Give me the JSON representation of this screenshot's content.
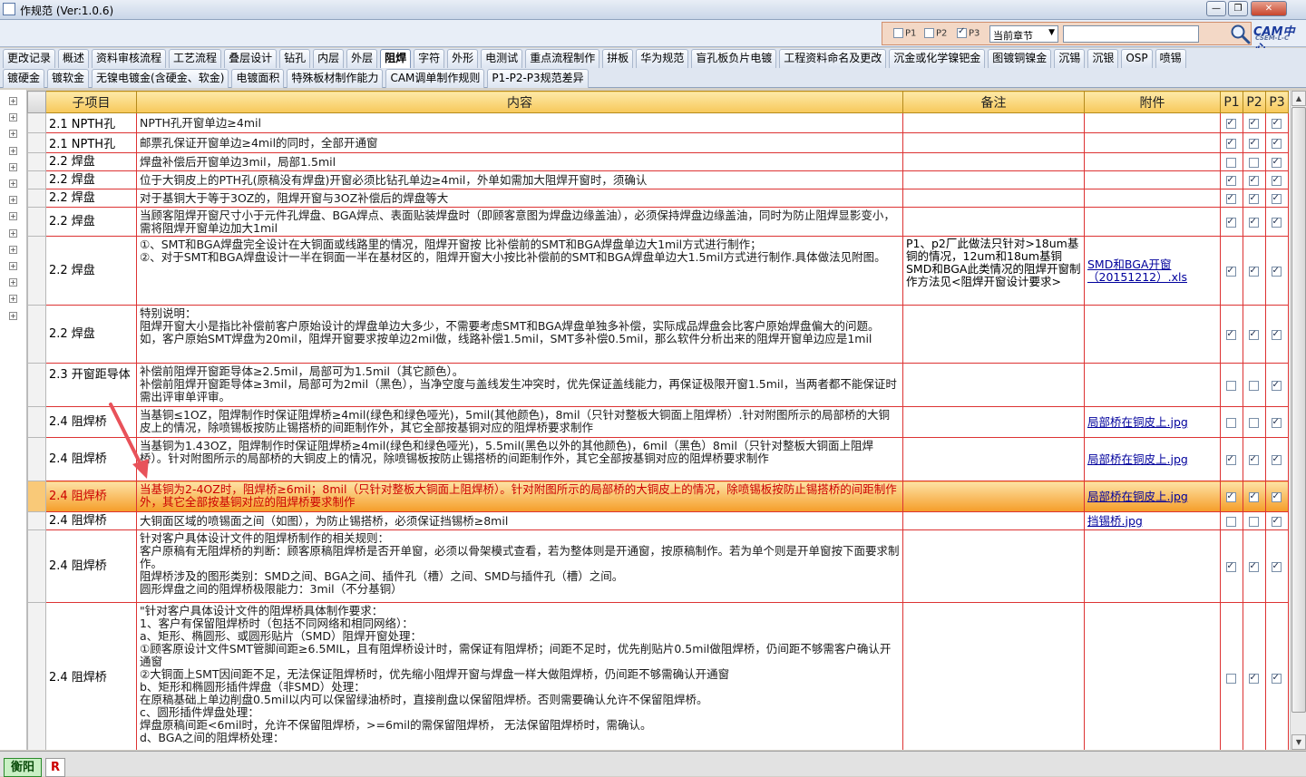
{
  "window": {
    "title": "作规范 (Ver:1.0.6)",
    "controls": [
      "—",
      "❐",
      "✕"
    ]
  },
  "toolbar": {
    "filters": [
      {
        "label": "P1",
        "checked": false
      },
      {
        "label": "P2",
        "checked": false
      },
      {
        "label": "P3",
        "checked": true
      }
    ],
    "chapter_select": "当前章节",
    "search_value": "",
    "logo_text": "CAM中心",
    "logo_sub": "CSEM-L-C"
  },
  "tabs_row1": [
    "更改记录",
    "概述",
    "资料审核流程",
    "工艺流程",
    "叠层设计",
    "钻孔",
    "内层",
    "外层",
    "阻焊",
    "字符",
    "外形",
    "电测试",
    "重点流程制作",
    "拼板",
    "华为规范",
    "盲孔板负片电镀",
    "工程资料命名及更改",
    "沉金或化学镍钯金",
    "图镀铜镍金",
    "沉锡",
    "沉银",
    "OSP",
    "喷锡"
  ],
  "tabs_row2": [
    "镀硬金",
    "镀软金",
    "无镍电镀金(含硬金、软金)",
    "电镀面积",
    "特殊板材制作能力",
    "CAM调单制作规则",
    "P1-P2-P3规范差异"
  ],
  "active_tab": "阻焊",
  "table": {
    "headers": [
      "子项目",
      "内容",
      "备注",
      "附件",
      "P1",
      "P2",
      "P3"
    ],
    "rows": [
      {
        "sub": "2.1 NPTH孔",
        "content": "NPTH孔开窗单边≥4mil",
        "note": "",
        "att": "",
        "p": [
          true,
          true,
          true
        ]
      },
      {
        "sub": "2.1 NPTH孔",
        "content": "邮票孔保证开窗单边≥4mil的同时，全部开通窗",
        "note": "",
        "att": "",
        "p": [
          true,
          true,
          true
        ]
      },
      {
        "sub": "2.2 焊盘",
        "content": "焊盘补偿后开窗单边3mil，局部1.5mil",
        "note": "",
        "att": "",
        "p": [
          false,
          false,
          true
        ]
      },
      {
        "sub": "2.2 焊盘",
        "content": "位于大铜皮上的PTH孔(原稿没有焊盘)开窗必须比钻孔单边≥4mil，外单如需加大阻焊开窗时，须确认",
        "note": "",
        "att": "",
        "p": [
          true,
          true,
          true
        ]
      },
      {
        "sub": "2.2 焊盘",
        "content": "对于基铜大于等于3OZ的，阻焊开窗与3OZ补偿后的焊盘等大",
        "note": "",
        "att": "",
        "p": [
          true,
          true,
          true
        ]
      },
      {
        "sub": "2.2 焊盘",
        "content": "当顾客阻焊开窗尺寸小于元件孔焊盘、BGA焊点、表面贴装焊盘时（即顾客意图为焊盘边缘盖油），必须保持焊盘边缘盖油，同时为防止阻焊显影变小，需将阻焊开窗单边加大1mil",
        "note": "",
        "att": "",
        "p": [
          true,
          true,
          true
        ]
      },
      {
        "sub": "2.2 焊盘",
        "content": "①、SMT和BGA焊盘完全设计在大铜面或线路里的情况，阻焊开窗按 比补偿前的SMT和BGA焊盘单边大1mil方式进行制作；\n②、对于SMT和BGA焊盘设计一半在铜面一半在基材区的，阻焊开窗大小按比补偿前的SMT和BGA焊盘单边大1.5mil方式进行制作.具体做法见附图。",
        "note": "P1、p2厂此做法只针对>18um基铜的情况，12um和18um基铜SMD和BGA此类情况的阻焊开窗制作方法见<阻焊开窗设计要求>",
        "att": "SMD和BGA开窗（20151212）.xls",
        "p": [
          true,
          true,
          true
        ]
      },
      {
        "sub": "2.2 焊盘",
        "content": "特别说明：\n阻焊开窗大小是指比补偿前客户原始设计的焊盘单边大多少，不需要考虑SMT和BGA焊盘单独多补偿，实际成品焊盘会比客户原始焊盘偏大的问题。如，客户原始SMT焊盘为20mil，阻焊开窗要求按单边2mil做，线路补偿1.5mil，SMT多补偿0.5mil，那么软件分析出来的阻焊开窗单边应是1mil",
        "note": "",
        "att": "",
        "p": [
          true,
          true,
          true
        ]
      },
      {
        "sub": "2.3 开窗距导体",
        "content": "      补偿前阻焊开窗距导体≥2.5mil，局部可为1.5mil（其它颜色）。\n      补偿前阻焊开窗距导体≥3mil，局部可为2mil（黑色），当净空度与盖线发生冲突时，优先保证盖线能力，再保证极限开窗1.5mil，当两者都不能保证时需出评审单评审。",
        "note": "",
        "att": "",
        "p": [
          false,
          false,
          true
        ]
      },
      {
        "sub": "2.4 阻焊桥",
        "content": "当基铜≤1OZ，阻焊制作时保证阻焊桥≥4mil(绿色和绿色哑光)，5mil(其他颜色)，8mil（只针对整板大铜面上阻焊桥）.针对附图所示的局部桥的大铜皮上的情况，除喷锡板按防止锡搭桥的间距制作外，其它全部按基铜对应的阻焊桥要求制作",
        "note": "",
        "att": "局部桥在铜皮上.jpg",
        "p": [
          false,
          false,
          true
        ]
      },
      {
        "sub": "2.4 阻焊桥",
        "content": "当基铜为1.43OZ，阻焊制作时保证阻焊桥≥4mil(绿色和绿色哑光)，5.5mil(黑色以外的其他颜色)，6mil（黑色）8mil（只针对整板大铜面上阻焊桥）。针对附图所示的局部桥的大铜皮上的情况，除喷锡板按防止锡搭桥的间距制作外，其它全部按基铜对应的阻焊桥要求制作",
        "note": "",
        "att": "局部桥在铜皮上.jpg",
        "p": [
          true,
          true,
          true
        ]
      },
      {
        "sub": "2.4 阻焊桥",
        "content": "当基铜为2-4OZ时，阻焊桥≥6mil；8mil（只针对整板大铜面上阻焊桥）。针对附图所示的局部桥的大铜皮上的情况，除喷锡板按防止锡搭桥的间距制作外，其它全部按基铜对应的阻焊桥要求制作",
        "note": "",
        "att": "局部桥在铜皮上.jpg",
        "p": [
          true,
          true,
          true
        ],
        "highlight": true
      },
      {
        "sub": "2.4 阻焊桥",
        "content": "大铜面区域的喷锡面之间（如图），为防止锡搭桥，必须保证挡锡桥≥8mil",
        "note": "",
        "att": "挡锡桥.jpg",
        "p": [
          false,
          false,
          true
        ]
      },
      {
        "sub": "2.4 阻焊桥",
        "content": "针对客户具体设计文件的阻焊桥制作的相关规则：\n客户原稿有无阻焊桥的判断：顾客原稿阻焊桥是否开单窗，必须以骨架模式查看，若为整体则是开通窗，按原稿制作。若为单个则是开单窗按下面要求制作。\n阻焊桥涉及的图形类别：SMD之间、BGA之间、插件孔（槽）之间、SMD与插件孔（槽）之间。\n圆形焊盘之间的阻焊桥极限能力：3mil（不分基铜）",
        "note": "",
        "att": "",
        "p": [
          true,
          true,
          true
        ]
      },
      {
        "sub": "2.4 阻焊桥",
        "content": "\"针对客户具体设计文件的阻焊桥具体制作要求：\n1、客户有保留阻焊桥时（包括不同网络和相同网络）：\na、矩形、椭圆形、或圆形贴片（SMD）阻焊开窗处理：\n①顾客原设计文件SMT管脚间距≥6.5MIL，且有阻焊桥设计时，需保证有阻焊桥；间距不足时，优先削贴片0.5mil做阻焊桥，仍间距不够需客户确认开通窗\n②大铜面上SMT因间距不足，无法保证阻焊桥时，优先缩小阻焊开窗与焊盘一样大做阻焊桥，仍间距不够需确认开通窗\nb、矩形和椭圆形插件焊盘（非SMD）处理：\n在原稿基础上单边削盘0.5mil以内可以保留绿油桥时，直接削盘以保留阻焊桥。否则需要确认允许不保留阻焊桥。\nc、圆形插件焊盘处理：\n焊盘原稿间距<6mil时，允许不保留阻焊桥，>=6mil的需保留阻焊桥， 无法保留阻焊桥时，需确认。\nd、BGA之间的阻焊桥处理：",
        "note": "",
        "att": "",
        "p": [
          false,
          true,
          true
        ]
      }
    ]
  },
  "status": {
    "left": "衡阳",
    "badge": "R"
  },
  "colors": {
    "header_gold": "#f7c85a",
    "grid_red": "#dd3333",
    "highlight_orange": "#f59d28",
    "link_blue": "#00009c"
  }
}
